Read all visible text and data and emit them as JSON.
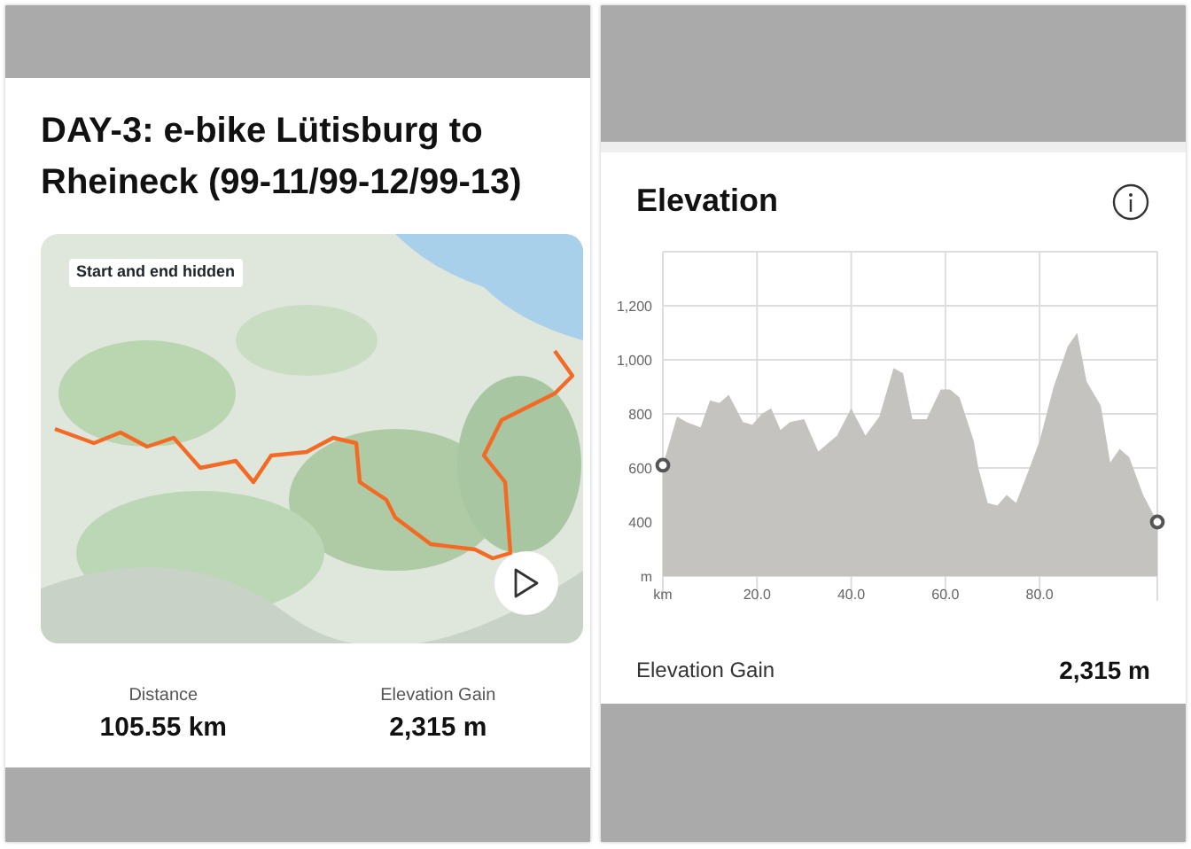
{
  "route_card": {
    "title": "DAY-3: e-bike Lütisburg to Rheineck (99-11/99-12/99-13)",
    "map": {
      "kind": "picture",
      "overlay_label": "Start and end hidden"
    },
    "stats": [
      {
        "label": "Distance",
        "value": "105.55 km"
      },
      {
        "label": "Elevation Gain",
        "value": "2,315 m"
      }
    ]
  },
  "elevation_card": {
    "title": "Elevation",
    "chart_data": {
      "type": "area",
      "grid": true,
      "xlim": [
        0,
        105
      ],
      "ylim": [
        200,
        1400
      ],
      "xticks": [
        {
          "value": 0,
          "label": "km"
        },
        {
          "value": 20,
          "label": "20.0"
        },
        {
          "value": 40,
          "label": "40.0"
        },
        {
          "value": 60,
          "label": "60.0"
        },
        {
          "value": 80,
          "label": "80.0"
        }
      ],
      "yticks": [
        {
          "value": 200,
          "label": "m"
        },
        {
          "value": 400,
          "label": "400"
        },
        {
          "value": 600,
          "label": "600"
        },
        {
          "value": 800,
          "label": "800"
        },
        {
          "value": 1000,
          "label": "1,000"
        },
        {
          "value": 1200,
          "label": "1,200"
        }
      ],
      "x": [
        0,
        3,
        5,
        8,
        10,
        12,
        14,
        17,
        19,
        21,
        23,
        25,
        27,
        30,
        33,
        37,
        40,
        43,
        46,
        49,
        51,
        53,
        56,
        59,
        61,
        63,
        66,
        67,
        69,
        71,
        73,
        75,
        77,
        80,
        83,
        86,
        88,
        90,
        93,
        95,
        97,
        99,
        102,
        105
      ],
      "series": [
        {
          "color": "#c4c3bf",
          "values": [
            610,
            790,
            770,
            750,
            850,
            840,
            870,
            770,
            760,
            800,
            820,
            740,
            770,
            780,
            660,
            720,
            820,
            720,
            790,
            970,
            950,
            780,
            780,
            890,
            890,
            860,
            700,
            600,
            470,
            460,
            500,
            470,
            560,
            700,
            900,
            1050,
            1100,
            920,
            830,
            620,
            670,
            640,
            500,
            400
          ]
        }
      ]
    },
    "summary": {
      "label": "Elevation Gain",
      "value": "2,315 m"
    }
  }
}
